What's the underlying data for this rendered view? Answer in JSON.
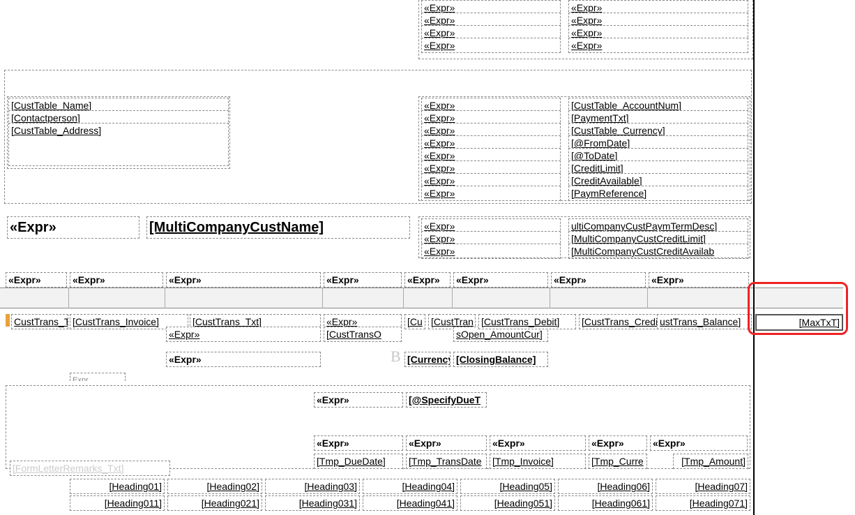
{
  "expr": "«Expr»",
  "top_col1": [
    "«Expr»",
    "«Expr»",
    "«Expr»",
    "«Expr»"
  ],
  "top_col2": [
    "«Expr»",
    "«Expr»",
    "«Expr»",
    "«Expr»"
  ],
  "cust_box": {
    "name": "[CustTable_Name]",
    "contact": "[Contactperson]",
    "address": "[CustTable_Address]"
  },
  "details_labels": [
    "«Expr»",
    "«Expr»",
    "«Expr»",
    "«Expr»",
    "«Expr»",
    "«Expr»",
    "«Expr»",
    "«Expr»"
  ],
  "details_values": [
    "[CustTable_AccountNum]",
    "[PaymentTxt]",
    "[CustTable_Currency]",
    "[@FromDate]",
    "[@ToDate]",
    "[CreditLimit]",
    "[CreditAvailable]",
    "[PaymReference]"
  ],
  "title_row": {
    "left": "«Expr»",
    "center": "[MultiCompanyCustName]",
    "r_labels": [
      "«Expr»",
      "«Expr»",
      "«Expr»"
    ],
    "r_values": [
      "ultiCompanyCustPaymTermDesc]",
      "[MultiCompanyCustCreditLimit]",
      "[MultiCompanyCustCreditAvailab"
    ]
  },
  "header_row": [
    "«Expr»",
    "«Expr»",
    "«Expr»",
    "«Expr»",
    "«Expr»",
    "«Expr»",
    "«Expr»",
    "«Expr»"
  ],
  "trans": {
    "c1": "CustTrans_T",
    "c2": "[CustTrans_Invoice]",
    "c3a": "[CustTrans_Txt]",
    "c3b": "«Expr»",
    "c4a": "«Expr»",
    "c4b": "[CustTransO",
    "c5": "[Cu",
    "c6a": "[CustTran",
    "c6b": "sOpen_AmountCur]",
    "c7": "[CustTrans_Debit]",
    "c8": "[CustTrans_Credit]",
    "c9": "ustTrans_Balance]",
    "maxtxt": "[MaxTxT]"
  },
  "closing": {
    "expr": "«Expr»",
    "curr": "[Currency",
    "bal": "[ClosingBalance]"
  },
  "due_row": {
    "expr": "«Expr»",
    "due": "[@SpecifyDueT"
  },
  "sub_headers": [
    "«Expr»",
    "«Expr»",
    "«Expr»",
    "«Expr»",
    "«Expr»"
  ],
  "tmp_row": [
    "[Tmp_DueDate]",
    "[Tmp_TransDate",
    "[Tmp_Invoice]",
    "[Tmp_Curre",
    "[Tmp_Amount]"
  ],
  "form_letter": "[FormLetterRemarks_Txt]",
  "heading1": [
    "[Heading01]",
    "[Heading02]",
    "[Heading03]",
    "[Heading04]",
    "[Heading05]",
    "[Heading06]",
    "[Heading07]"
  ],
  "heading2": [
    "[Heading011]",
    "[Heading021]",
    "[Heading031]",
    "[Heading041]",
    "[Heading051]",
    "[Heading061]",
    "[Heading071]"
  ]
}
